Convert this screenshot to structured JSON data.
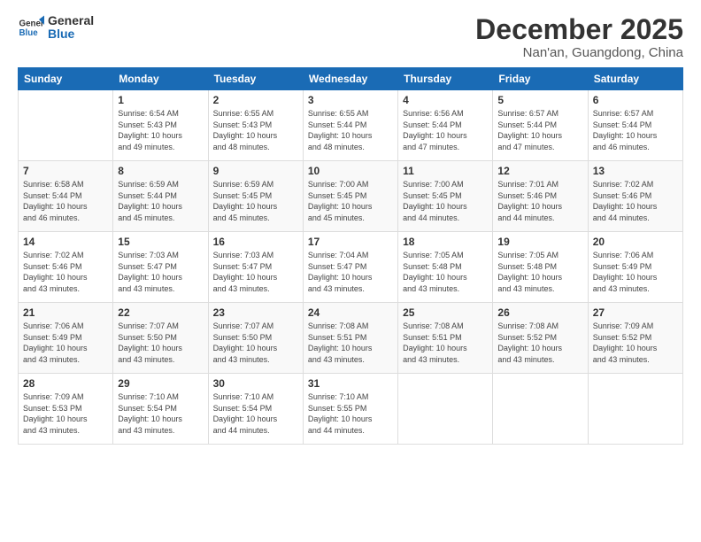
{
  "logo": {
    "line1": "General",
    "line2": "Blue"
  },
  "title": "December 2025",
  "subtitle": "Nan'an, Guangdong, China",
  "weekdays": [
    "Sunday",
    "Monday",
    "Tuesday",
    "Wednesday",
    "Thursday",
    "Friday",
    "Saturday"
  ],
  "weeks": [
    [
      {
        "day": "",
        "info": ""
      },
      {
        "day": "1",
        "info": "Sunrise: 6:54 AM\nSunset: 5:43 PM\nDaylight: 10 hours\nand 49 minutes."
      },
      {
        "day": "2",
        "info": "Sunrise: 6:55 AM\nSunset: 5:43 PM\nDaylight: 10 hours\nand 48 minutes."
      },
      {
        "day": "3",
        "info": "Sunrise: 6:55 AM\nSunset: 5:44 PM\nDaylight: 10 hours\nand 48 minutes."
      },
      {
        "day": "4",
        "info": "Sunrise: 6:56 AM\nSunset: 5:44 PM\nDaylight: 10 hours\nand 47 minutes."
      },
      {
        "day": "5",
        "info": "Sunrise: 6:57 AM\nSunset: 5:44 PM\nDaylight: 10 hours\nand 47 minutes."
      },
      {
        "day": "6",
        "info": "Sunrise: 6:57 AM\nSunset: 5:44 PM\nDaylight: 10 hours\nand 46 minutes."
      }
    ],
    [
      {
        "day": "7",
        "info": "Sunrise: 6:58 AM\nSunset: 5:44 PM\nDaylight: 10 hours\nand 46 minutes."
      },
      {
        "day": "8",
        "info": "Sunrise: 6:59 AM\nSunset: 5:44 PM\nDaylight: 10 hours\nand 45 minutes."
      },
      {
        "day": "9",
        "info": "Sunrise: 6:59 AM\nSunset: 5:45 PM\nDaylight: 10 hours\nand 45 minutes."
      },
      {
        "day": "10",
        "info": "Sunrise: 7:00 AM\nSunset: 5:45 PM\nDaylight: 10 hours\nand 45 minutes."
      },
      {
        "day": "11",
        "info": "Sunrise: 7:00 AM\nSunset: 5:45 PM\nDaylight: 10 hours\nand 44 minutes."
      },
      {
        "day": "12",
        "info": "Sunrise: 7:01 AM\nSunset: 5:46 PM\nDaylight: 10 hours\nand 44 minutes."
      },
      {
        "day": "13",
        "info": "Sunrise: 7:02 AM\nSunset: 5:46 PM\nDaylight: 10 hours\nand 44 minutes."
      }
    ],
    [
      {
        "day": "14",
        "info": "Sunrise: 7:02 AM\nSunset: 5:46 PM\nDaylight: 10 hours\nand 43 minutes."
      },
      {
        "day": "15",
        "info": "Sunrise: 7:03 AM\nSunset: 5:47 PM\nDaylight: 10 hours\nand 43 minutes."
      },
      {
        "day": "16",
        "info": "Sunrise: 7:03 AM\nSunset: 5:47 PM\nDaylight: 10 hours\nand 43 minutes."
      },
      {
        "day": "17",
        "info": "Sunrise: 7:04 AM\nSunset: 5:47 PM\nDaylight: 10 hours\nand 43 minutes."
      },
      {
        "day": "18",
        "info": "Sunrise: 7:05 AM\nSunset: 5:48 PM\nDaylight: 10 hours\nand 43 minutes."
      },
      {
        "day": "19",
        "info": "Sunrise: 7:05 AM\nSunset: 5:48 PM\nDaylight: 10 hours\nand 43 minutes."
      },
      {
        "day": "20",
        "info": "Sunrise: 7:06 AM\nSunset: 5:49 PM\nDaylight: 10 hours\nand 43 minutes."
      }
    ],
    [
      {
        "day": "21",
        "info": "Sunrise: 7:06 AM\nSunset: 5:49 PM\nDaylight: 10 hours\nand 43 minutes."
      },
      {
        "day": "22",
        "info": "Sunrise: 7:07 AM\nSunset: 5:50 PM\nDaylight: 10 hours\nand 43 minutes."
      },
      {
        "day": "23",
        "info": "Sunrise: 7:07 AM\nSunset: 5:50 PM\nDaylight: 10 hours\nand 43 minutes."
      },
      {
        "day": "24",
        "info": "Sunrise: 7:08 AM\nSunset: 5:51 PM\nDaylight: 10 hours\nand 43 minutes."
      },
      {
        "day": "25",
        "info": "Sunrise: 7:08 AM\nSunset: 5:51 PM\nDaylight: 10 hours\nand 43 minutes."
      },
      {
        "day": "26",
        "info": "Sunrise: 7:08 AM\nSunset: 5:52 PM\nDaylight: 10 hours\nand 43 minutes."
      },
      {
        "day": "27",
        "info": "Sunrise: 7:09 AM\nSunset: 5:52 PM\nDaylight: 10 hours\nand 43 minutes."
      }
    ],
    [
      {
        "day": "28",
        "info": "Sunrise: 7:09 AM\nSunset: 5:53 PM\nDaylight: 10 hours\nand 43 minutes."
      },
      {
        "day": "29",
        "info": "Sunrise: 7:10 AM\nSunset: 5:54 PM\nDaylight: 10 hours\nand 43 minutes."
      },
      {
        "day": "30",
        "info": "Sunrise: 7:10 AM\nSunset: 5:54 PM\nDaylight: 10 hours\nand 44 minutes."
      },
      {
        "day": "31",
        "info": "Sunrise: 7:10 AM\nSunset: 5:55 PM\nDaylight: 10 hours\nand 44 minutes."
      },
      {
        "day": "",
        "info": ""
      },
      {
        "day": "",
        "info": ""
      },
      {
        "day": "",
        "info": ""
      }
    ]
  ]
}
